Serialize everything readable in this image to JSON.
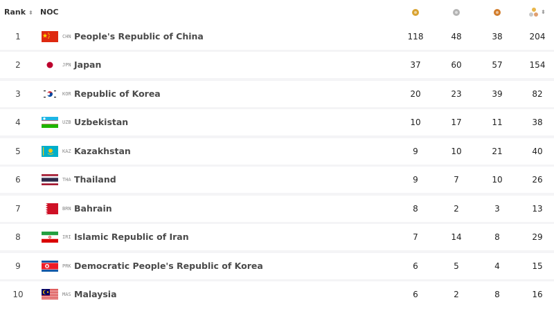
{
  "header": {
    "rank_label": "Rank",
    "noc_label": "NOC",
    "sort_glyph": "⬍",
    "medal_icons": {
      "gold": "gold-medal-icon",
      "silver": "silver-medal-icon",
      "bronze": "bronze-medal-icon",
      "total": "total-medals-icon"
    }
  },
  "colors": {
    "gold": "#d9a332",
    "silver": "#b4b4b4",
    "bronze": "#d27d2c",
    "row_bg": "#ffffff",
    "page_bg": "#f4f4f6"
  },
  "rows": [
    {
      "rank": "1",
      "code": "CHN",
      "name": "People's Republic of China",
      "gold": "118",
      "silver": "48",
      "bronze": "38",
      "total": "204"
    },
    {
      "rank": "2",
      "code": "JPN",
      "name": "Japan",
      "gold": "37",
      "silver": "60",
      "bronze": "57",
      "total": "154"
    },
    {
      "rank": "3",
      "code": "KOR",
      "name": "Republic of Korea",
      "gold": "20",
      "silver": "23",
      "bronze": "39",
      "total": "82"
    },
    {
      "rank": "4",
      "code": "UZB",
      "name": "Uzbekistan",
      "gold": "10",
      "silver": "17",
      "bronze": "11",
      "total": "38"
    },
    {
      "rank": "5",
      "code": "KAZ",
      "name": "Kazakhstan",
      "gold": "9",
      "silver": "10",
      "bronze": "21",
      "total": "40"
    },
    {
      "rank": "6",
      "code": "THA",
      "name": "Thailand",
      "gold": "9",
      "silver": "7",
      "bronze": "10",
      "total": "26"
    },
    {
      "rank": "7",
      "code": "BRN",
      "name": "Bahrain",
      "gold": "8",
      "silver": "2",
      "bronze": "3",
      "total": "13"
    },
    {
      "rank": "8",
      "code": "IRI",
      "name": "Islamic Republic of Iran",
      "gold": "7",
      "silver": "14",
      "bronze": "8",
      "total": "29"
    },
    {
      "rank": "9",
      "code": "PRK",
      "name": "Democratic People's Republic of Korea",
      "gold": "6",
      "silver": "5",
      "bronze": "4",
      "total": "15"
    },
    {
      "rank": "10",
      "code": "MAS",
      "name": "Malaysia",
      "gold": "6",
      "silver": "2",
      "bronze": "8",
      "total": "16"
    }
  ]
}
